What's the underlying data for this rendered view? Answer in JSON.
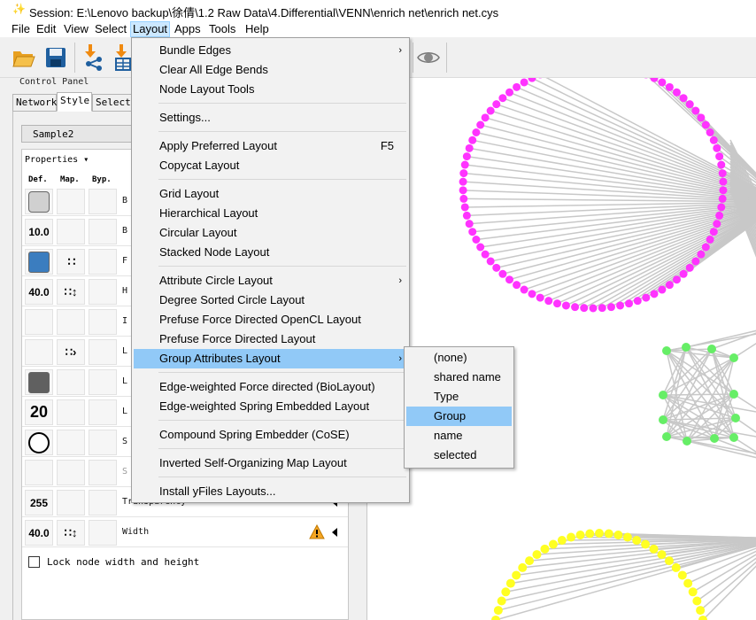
{
  "window": {
    "title": "Session: E:\\Lenovo backup\\徐倩\\1.2 Raw Data\\4.Differential\\VENN\\enrich net\\enrich net.cys"
  },
  "menubar": [
    "File",
    "Edit",
    "View",
    "Select",
    "Layout",
    "Apps",
    "Tools",
    "Help"
  ],
  "control_panel": {
    "label": "Control Panel",
    "tabs": [
      "Network",
      "Style",
      "Select"
    ],
    "selected_tab": "Style",
    "style_name": "Sample2",
    "properties_label": "Properties",
    "columns": [
      "Def.",
      "Map.",
      "Byp."
    ],
    "rows": [
      {
        "def": "",
        "label": "B"
      },
      {
        "def": "10.0",
        "label": "B"
      },
      {
        "def": "",
        "label": "F"
      },
      {
        "def": "40.0",
        "label": "H"
      },
      {
        "def": "",
        "label": "I"
      },
      {
        "def": "",
        "label": "L"
      },
      {
        "def": "",
        "label": "L"
      },
      {
        "def": "20",
        "label": "L"
      },
      {
        "def": "",
        "label": "S"
      },
      {
        "def": "",
        "label": "S"
      },
      {
        "def": "255",
        "label": "Transparency"
      },
      {
        "def": "40.0",
        "label": "Width"
      }
    ],
    "lock_label": "Lock node width and height"
  },
  "layout_menu": {
    "items": [
      {
        "label": "Bundle Edges",
        "submenu": true
      },
      {
        "label": "Clear All Edge Bends"
      },
      {
        "label": "Node Layout Tools"
      },
      {
        "label": "Settings..."
      },
      {
        "label": "Apply Preferred Layout",
        "shortcut": "F5"
      },
      {
        "label": "Copycat Layout"
      },
      {
        "label": "Grid Layout"
      },
      {
        "label": "Hierarchical Layout"
      },
      {
        "label": "Circular Layout"
      },
      {
        "label": "Stacked Node Layout"
      },
      {
        "label": "Attribute Circle Layout",
        "submenu": true
      },
      {
        "label": "Degree Sorted Circle Layout"
      },
      {
        "label": "Prefuse Force Directed OpenCL Layout"
      },
      {
        "label": "Prefuse Force Directed Layout"
      },
      {
        "label": "Group Attributes Layout",
        "submenu": true,
        "highlighted": true
      },
      {
        "label": "Edge-weighted Force directed (BioLayout)"
      },
      {
        "label": "Edge-weighted Spring Embedded Layout"
      },
      {
        "label": "Compound Spring Embedder (CoSE)"
      },
      {
        "label": "Inverted Self-Organizing Map Layout"
      },
      {
        "label": "Install yFiles Layouts..."
      }
    ]
  },
  "group_attributes_submenu": {
    "items": [
      "(none)",
      "shared name",
      "Type",
      "Group",
      "name",
      "selected"
    ],
    "highlighted": "Group"
  },
  "colors": {
    "menu_highlight": "#91c9f7",
    "node_magenta": "#ff33ff",
    "node_green": "#66ee66",
    "node_yellow": "#ffff22",
    "edge_gray": "#c8c8c8",
    "fill_blue": "#3b7dbf",
    "fill_gray_light": "#d0d0d0",
    "fill_gray_dark": "#606060"
  }
}
